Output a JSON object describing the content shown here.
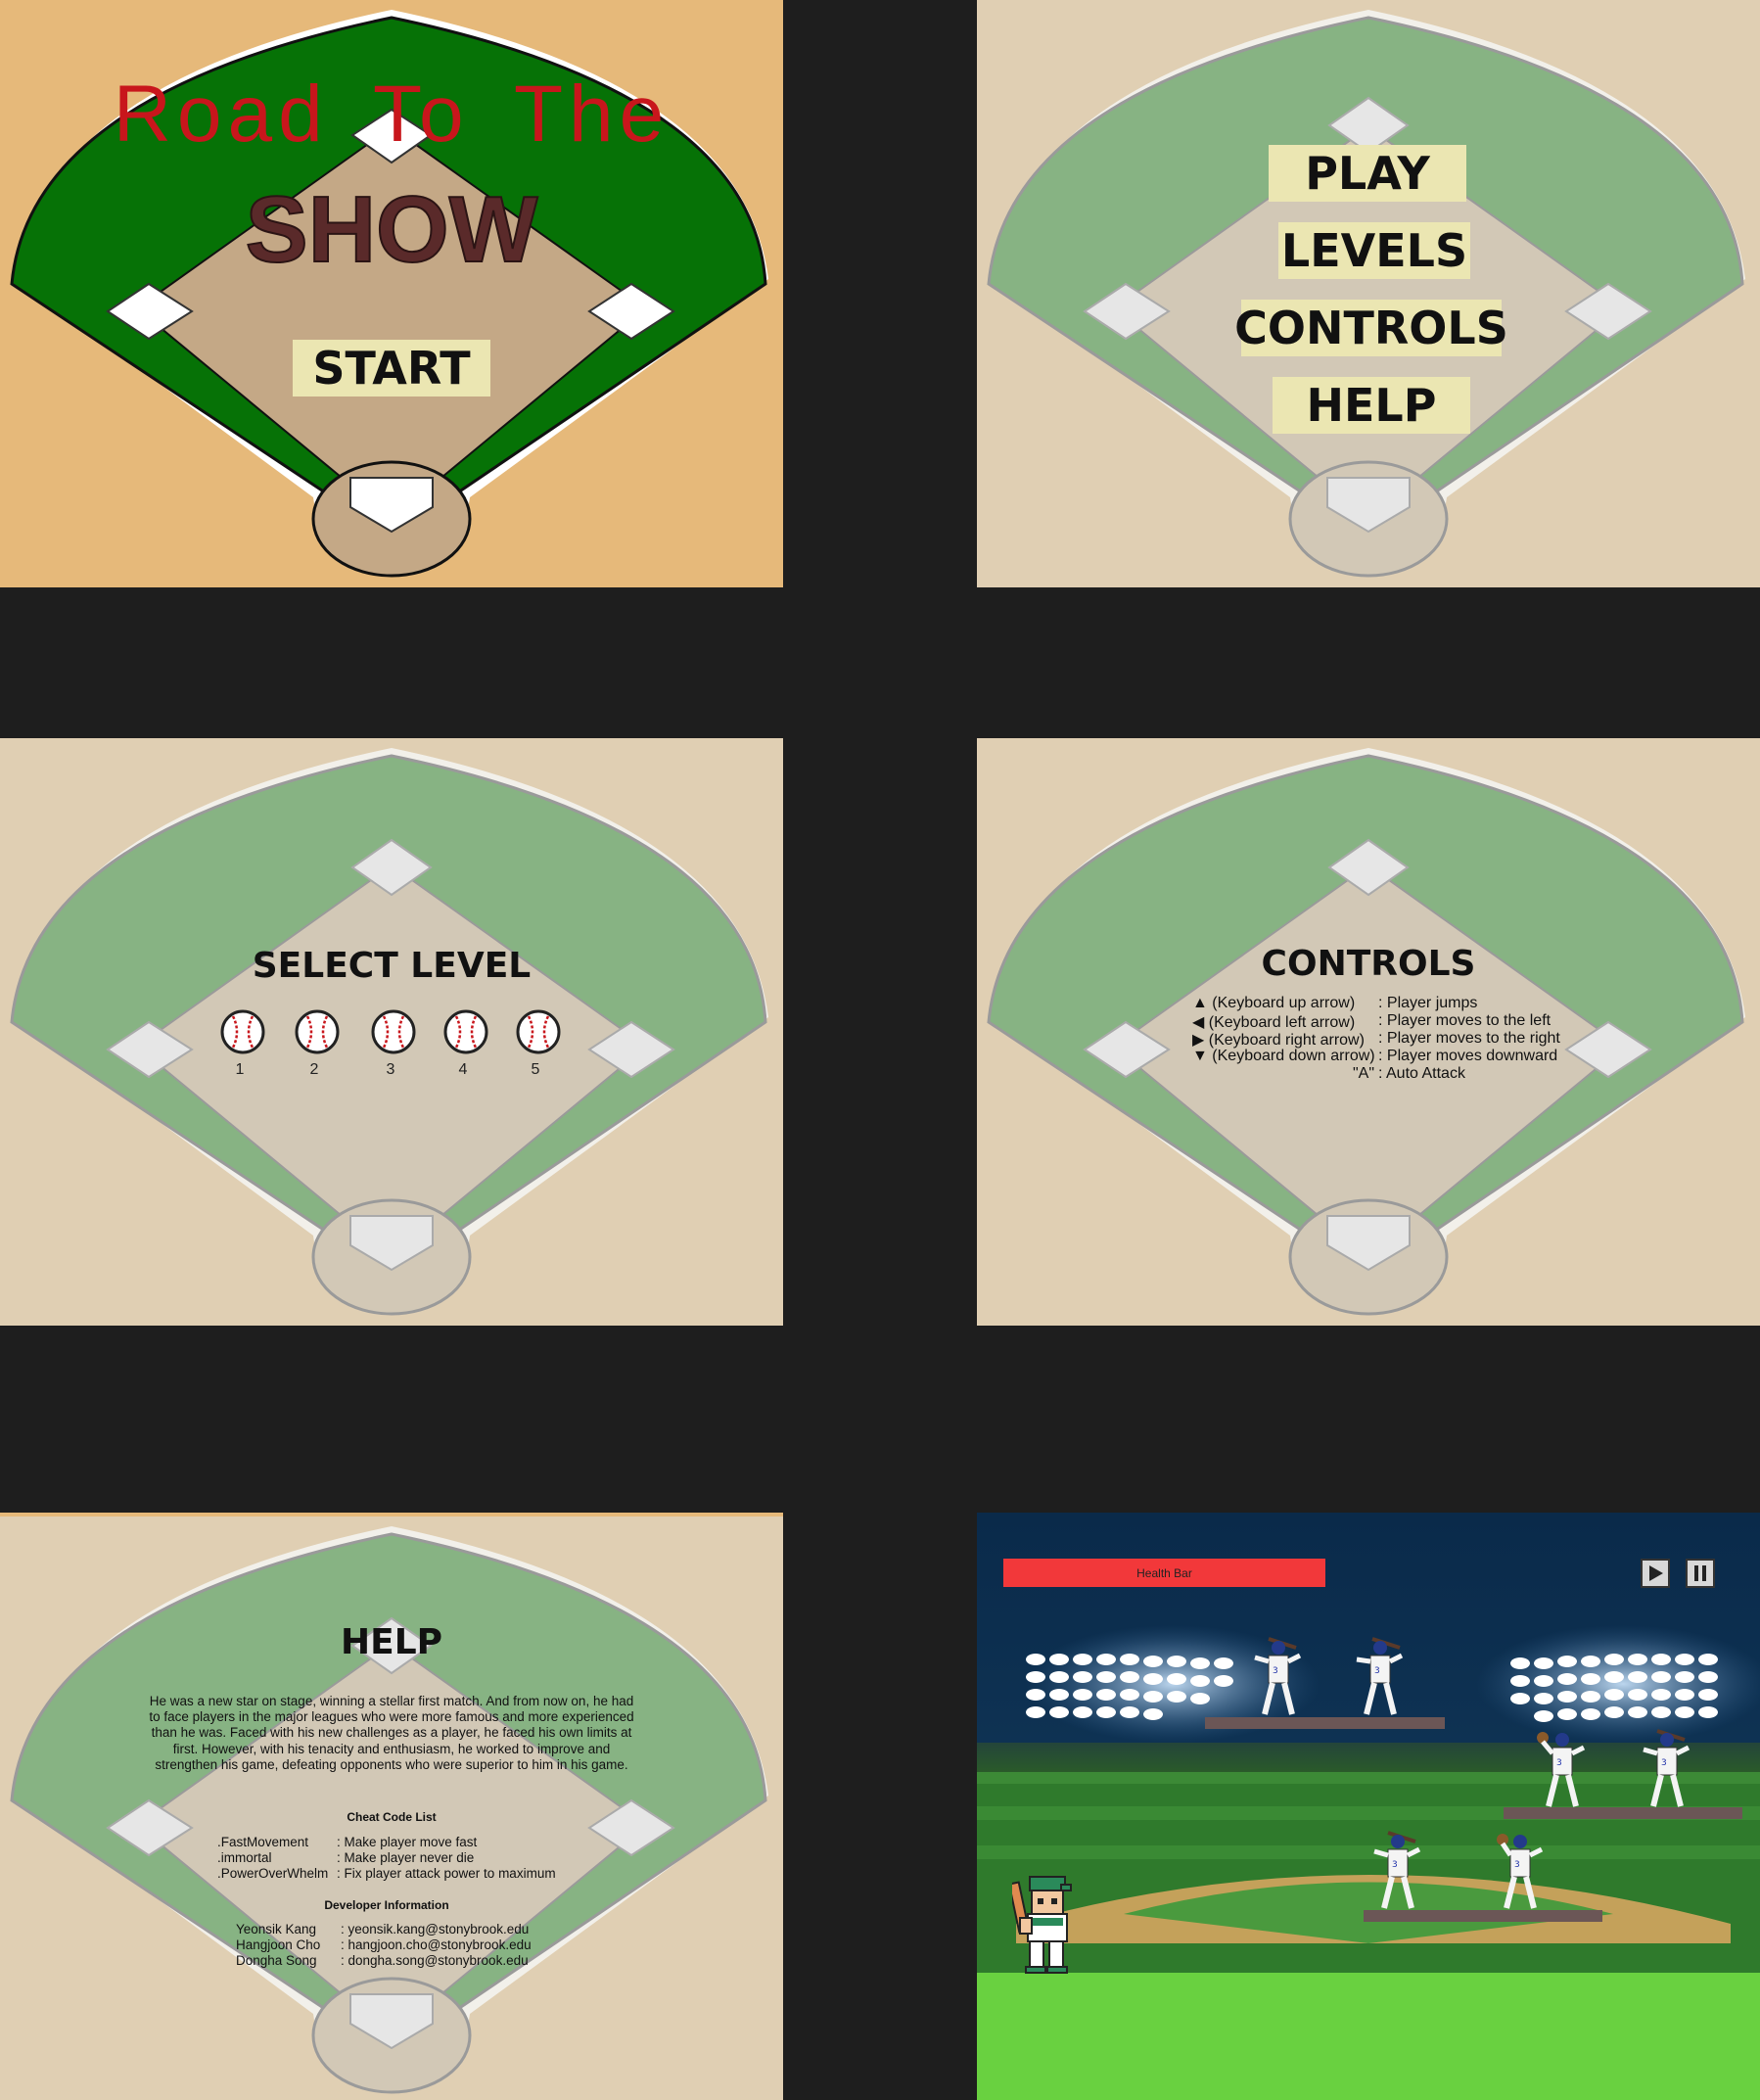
{
  "title_screen": {
    "title_line1": "Road To The",
    "title_line2": "SHOW",
    "start_label": "START",
    "background": "#e6b97a",
    "grass": "#067206"
  },
  "main_menu": {
    "items": [
      {
        "label": "PLAY"
      },
      {
        "label": "LEVELS"
      },
      {
        "label": "CONTROLS"
      },
      {
        "label": "HELP"
      }
    ],
    "background": "#e0cfb3",
    "grass": "#87b383"
  },
  "level_select": {
    "heading": "SELECT LEVEL",
    "levels": [
      "1",
      "2",
      "3",
      "4",
      "5"
    ]
  },
  "controls": {
    "heading": "CONTROLS",
    "rows": [
      {
        "key_icon": "up-arrow-icon",
        "key": "(Keyboard up arrow)",
        "action": ": Player jumps"
      },
      {
        "key_icon": "left-arrow-icon",
        "key": "(Keyboard left arrow)",
        "action": ": Player moves to the left"
      },
      {
        "key_icon": "right-arrow-icon",
        "key": "(Keyboard right arrow)",
        "action": ": Player moves to the right"
      },
      {
        "key_icon": "down-arrow-icon",
        "key": "(Keyboard down arrow)",
        "action": ": Player moves downward"
      },
      {
        "key_icon": "",
        "key": "\"A\"",
        "action": ": Auto Attack"
      }
    ]
  },
  "help": {
    "heading": "HELP",
    "story": "He was a new star on stage, winning a stellar first match. And from now on, he had to face players in the major leagues who were more famous and more experienced than he was. Faced with his new challenges as a player, he faced his own limits at first. However, with his tenacity and enthusiasm, he worked to improve and strengthen his game, defeating opponents who were superior to him in his game.",
    "cheat_title": "Cheat Code List",
    "cheats": [
      {
        "code": ".FastMovement",
        "desc": ": Make player move fast"
      },
      {
        "code": ".immortal",
        "desc": ": Make player never die"
      },
      {
        "code": ".PowerOverWhelm",
        "desc": ": Fix player attack power to maximum"
      }
    ],
    "dev_title": "Developer Information",
    "developers": [
      {
        "name": "Yeonsik Kang",
        "email": ": yeonsik.kang@stonybrook.edu"
      },
      {
        "name": "Hangjoon Cho",
        "email": ": hangjoon.cho@stonybrook.edu"
      },
      {
        "name": "Dongha Song",
        "email": ": dongha.song@stonybrook.edu"
      }
    ]
  },
  "gameplay": {
    "health_label": "Health Bar",
    "play_icon": "play-icon",
    "pause_icon": "pause-icon",
    "health_color": "#f2383a",
    "ground_color": "#69d140"
  }
}
